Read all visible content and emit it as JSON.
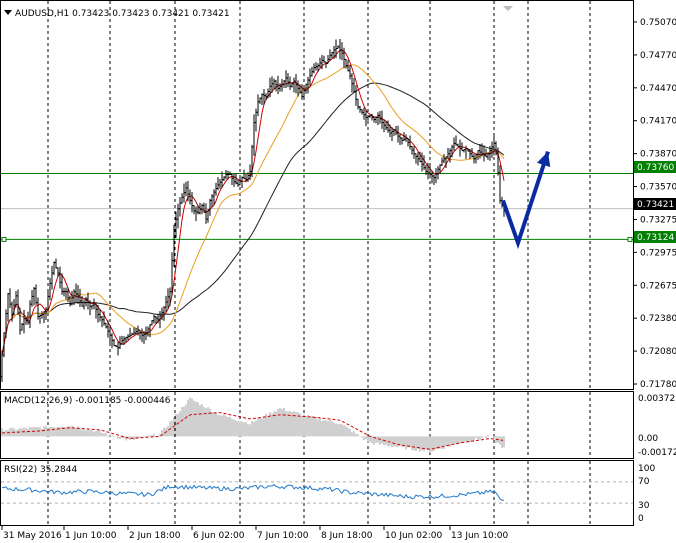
{
  "main_chart": {
    "header": "AUDUSD,H1  0.73423 0.73423 0.73421 0.73421",
    "price_levels": [
      "0.75070",
      "0.74770",
      "0.74470",
      "0.74170",
      "0.73870",
      "0.73570",
      "0.73275",
      "0.72975",
      "0.72675",
      "0.72380",
      "0.72080",
      "0.71780"
    ],
    "current_price": "0.73421",
    "resistance_level": "0.73760",
    "support_level": "0.73124",
    "colors": {
      "candles": "#000000",
      "ma_fast": "#d00000",
      "ma_mid": "#e8a020",
      "ma_slow": "#202020",
      "level_line": "#008000",
      "arrow": "#0a2aa0"
    }
  },
  "macd": {
    "header": "MACD(12,26,9) -0.001185 -0.000446",
    "levels": [
      "0.003727",
      "0.00",
      "-0.001724"
    ],
    "colors": {
      "histogram": "#a0a0a0",
      "signal": "#d00000"
    }
  },
  "rsi": {
    "header": "RSI(22) 35.2844",
    "levels": [
      "100",
      "70",
      "30",
      "0"
    ],
    "colors": {
      "line": "#1e78c8"
    }
  },
  "time_axis": {
    "labels": [
      "31 May 2016",
      "1 Jun 10:00",
      "2 Jun 18:00",
      "6 Jun 02:00",
      "7 Jun 10:00",
      "8 Jun 18:00",
      "10 Jun 02:00",
      "13 Jun 10:00"
    ]
  },
  "chart_data": {
    "type": "candlestick",
    "header": "AUDUSD,H1  0.73423 0.73423 0.73421 0.73421",
    "ylim": [
      0.7173,
      0.7522
    ],
    "resistance": 0.7376,
    "support": 0.73124,
    "current": 0.73421,
    "price_path": [
      [
        0,
        0.718
      ],
      [
        4,
        0.7222
      ],
      [
        8,
        0.726
      ],
      [
        12,
        0.724
      ],
      [
        16,
        0.7258
      ],
      [
        20,
        0.7225
      ],
      [
        24,
        0.7236
      ],
      [
        28,
        0.7232
      ],
      [
        30,
        0.725
      ],
      [
        34,
        0.7265
      ],
      [
        38,
        0.7238
      ],
      [
        42,
        0.724
      ],
      [
        46,
        0.7245
      ],
      [
        50,
        0.727
      ],
      [
        54,
        0.729
      ],
      [
        58,
        0.728
      ],
      [
        62,
        0.7262
      ],
      [
        66,
        0.7262
      ],
      [
        70,
        0.725
      ],
      [
        74,
        0.7262
      ],
      [
        78,
        0.7258
      ],
      [
        82,
        0.7248
      ],
      [
        86,
        0.7255
      ],
      [
        90,
        0.7248
      ],
      [
        94,
        0.725
      ],
      [
        98,
        0.724
      ],
      [
        102,
        0.7235
      ],
      [
        106,
        0.7228
      ],
      [
        110,
        0.722
      ],
      [
        114,
        0.721
      ],
      [
        118,
        0.7208
      ],
      [
        122,
        0.7215
      ],
      [
        126,
        0.7218
      ],
      [
        130,
        0.722
      ],
      [
        134,
        0.7222
      ],
      [
        138,
        0.7225
      ],
      [
        142,
        0.722
      ],
      [
        146,
        0.7222
      ],
      [
        150,
        0.723
      ],
      [
        154,
        0.7238
      ],
      [
        158,
        0.7235
      ],
      [
        162,
        0.7242
      ],
      [
        166,
        0.7252
      ],
      [
        170,
        0.7262
      ],
      [
        174,
        0.7322
      ],
      [
        178,
        0.7342
      ],
      [
        182,
        0.7353
      ],
      [
        186,
        0.7362
      ],
      [
        190,
        0.735
      ],
      [
        194,
        0.734
      ],
      [
        198,
        0.7338
      ],
      [
        202,
        0.7345
      ],
      [
        206,
        0.7332
      ],
      [
        210,
        0.735
      ],
      [
        214,
        0.7358
      ],
      [
        218,
        0.7365
      ],
      [
        222,
        0.737
      ],
      [
        226,
        0.7375
      ],
      [
        230,
        0.7375
      ],
      [
        234,
        0.7368
      ],
      [
        238,
        0.7365
      ],
      [
        242,
        0.7372
      ],
      [
        246,
        0.737
      ],
      [
        250,
        0.7378
      ],
      [
        254,
        0.7425
      ],
      [
        258,
        0.7445
      ],
      [
        262,
        0.7452
      ],
      [
        266,
        0.745
      ],
      [
        270,
        0.746
      ],
      [
        274,
        0.7465
      ],
      [
        278,
        0.7458
      ],
      [
        282,
        0.7462
      ],
      [
        286,
        0.7468
      ],
      [
        290,
        0.746
      ],
      [
        294,
        0.7465
      ],
      [
        298,
        0.7458
      ],
      [
        302,
        0.745
      ],
      [
        306,
        0.7462
      ],
      [
        310,
        0.747
      ],
      [
        314,
        0.7478
      ],
      [
        318,
        0.748
      ],
      [
        322,
        0.7485
      ],
      [
        326,
        0.7482
      ],
      [
        330,
        0.749
      ],
      [
        334,
        0.7495
      ],
      [
        338,
        0.7498
      ],
      [
        342,
        0.7492
      ],
      [
        346,
        0.748
      ],
      [
        350,
        0.747
      ],
      [
        354,
        0.7455
      ],
      [
        358,
        0.744
      ],
      [
        362,
        0.7435
      ],
      [
        366,
        0.743
      ],
      [
        370,
        0.7432
      ],
      [
        374,
        0.7428
      ],
      [
        378,
        0.7432
      ],
      [
        382,
        0.7425
      ],
      [
        386,
        0.742
      ],
      [
        390,
        0.7415
      ],
      [
        394,
        0.7418
      ],
      [
        398,
        0.7412
      ],
      [
        402,
        0.7408
      ],
      [
        406,
        0.741
      ],
      [
        410,
        0.7402
      ],
      [
        414,
        0.7395
      ],
      [
        418,
        0.739
      ],
      [
        422,
        0.7385
      ],
      [
        426,
        0.7378
      ],
      [
        430,
        0.7375
      ],
      [
        434,
        0.7372
      ],
      [
        438,
        0.738
      ],
      [
        442,
        0.7388
      ],
      [
        446,
        0.7392
      ],
      [
        450,
        0.7398
      ],
      [
        454,
        0.7405
      ],
      [
        458,
        0.7402
      ],
      [
        462,
        0.7398
      ],
      [
        466,
        0.74
      ],
      [
        470,
        0.7395
      ],
      [
        474,
        0.739
      ],
      [
        478,
        0.7398
      ],
      [
        482,
        0.7395
      ],
      [
        486,
        0.7392
      ],
      [
        490,
        0.7398
      ],
      [
        494,
        0.7405
      ],
      [
        497,
        0.739
      ],
      [
        500,
        0.735
      ],
      [
        503,
        0.7343
      ],
      [
        505,
        0.73421
      ]
    ],
    "forecast_arrow": [
      [
        503,
        0.735
      ],
      [
        518,
        0.7309
      ],
      [
        548,
        0.7397
      ]
    ],
    "macd_histogram": [
      [
        0,
        0.0006
      ],
      [
        40,
        0.0008
      ],
      [
        70,
        0.001
      ],
      [
        100,
        0.0004
      ],
      [
        130,
        -0.0004
      ],
      [
        160,
        0.0002
      ],
      [
        190,
        0.0035
      ],
      [
        220,
        0.002
      ],
      [
        250,
        0.0012
      ],
      [
        280,
        0.0026
      ],
      [
        310,
        0.0018
      ],
      [
        340,
        0.0012
      ],
      [
        370,
        -0.0006
      ],
      [
        400,
        -0.001
      ],
      [
        430,
        -0.0014
      ],
      [
        460,
        -0.0006
      ],
      [
        490,
        0.0
      ],
      [
        505,
        -0.0012
      ]
    ],
    "macd_signal": [
      [
        0,
        0.0003
      ],
      [
        40,
        0.0005
      ],
      [
        70,
        0.0008
      ],
      [
        100,
        0.0006
      ],
      [
        130,
        -0.0002
      ],
      [
        160,
        0.0
      ],
      [
        190,
        0.002
      ],
      [
        220,
        0.0022
      ],
      [
        250,
        0.0016
      ],
      [
        280,
        0.002
      ],
      [
        310,
        0.0018
      ],
      [
        340,
        0.0015
      ],
      [
        370,
        0.0
      ],
      [
        400,
        -0.0008
      ],
      [
        430,
        -0.0012
      ],
      [
        460,
        -0.0006
      ],
      [
        490,
        -0.0002
      ],
      [
        505,
        -0.0004
      ]
    ],
    "rsi_values": [
      [
        0,
        58
      ],
      [
        30,
        55
      ],
      [
        60,
        50
      ],
      [
        90,
        52
      ],
      [
        120,
        48
      ],
      [
        150,
        46
      ],
      [
        170,
        62
      ],
      [
        190,
        60
      ],
      [
        210,
        58
      ],
      [
        240,
        57
      ],
      [
        270,
        62
      ],
      [
        300,
        60
      ],
      [
        330,
        56
      ],
      [
        350,
        50
      ],
      [
        380,
        46
      ],
      [
        410,
        42
      ],
      [
        440,
        43
      ],
      [
        470,
        47
      ],
      [
        495,
        52
      ],
      [
        500,
        36
      ],
      [
        505,
        35.28
      ]
    ]
  }
}
